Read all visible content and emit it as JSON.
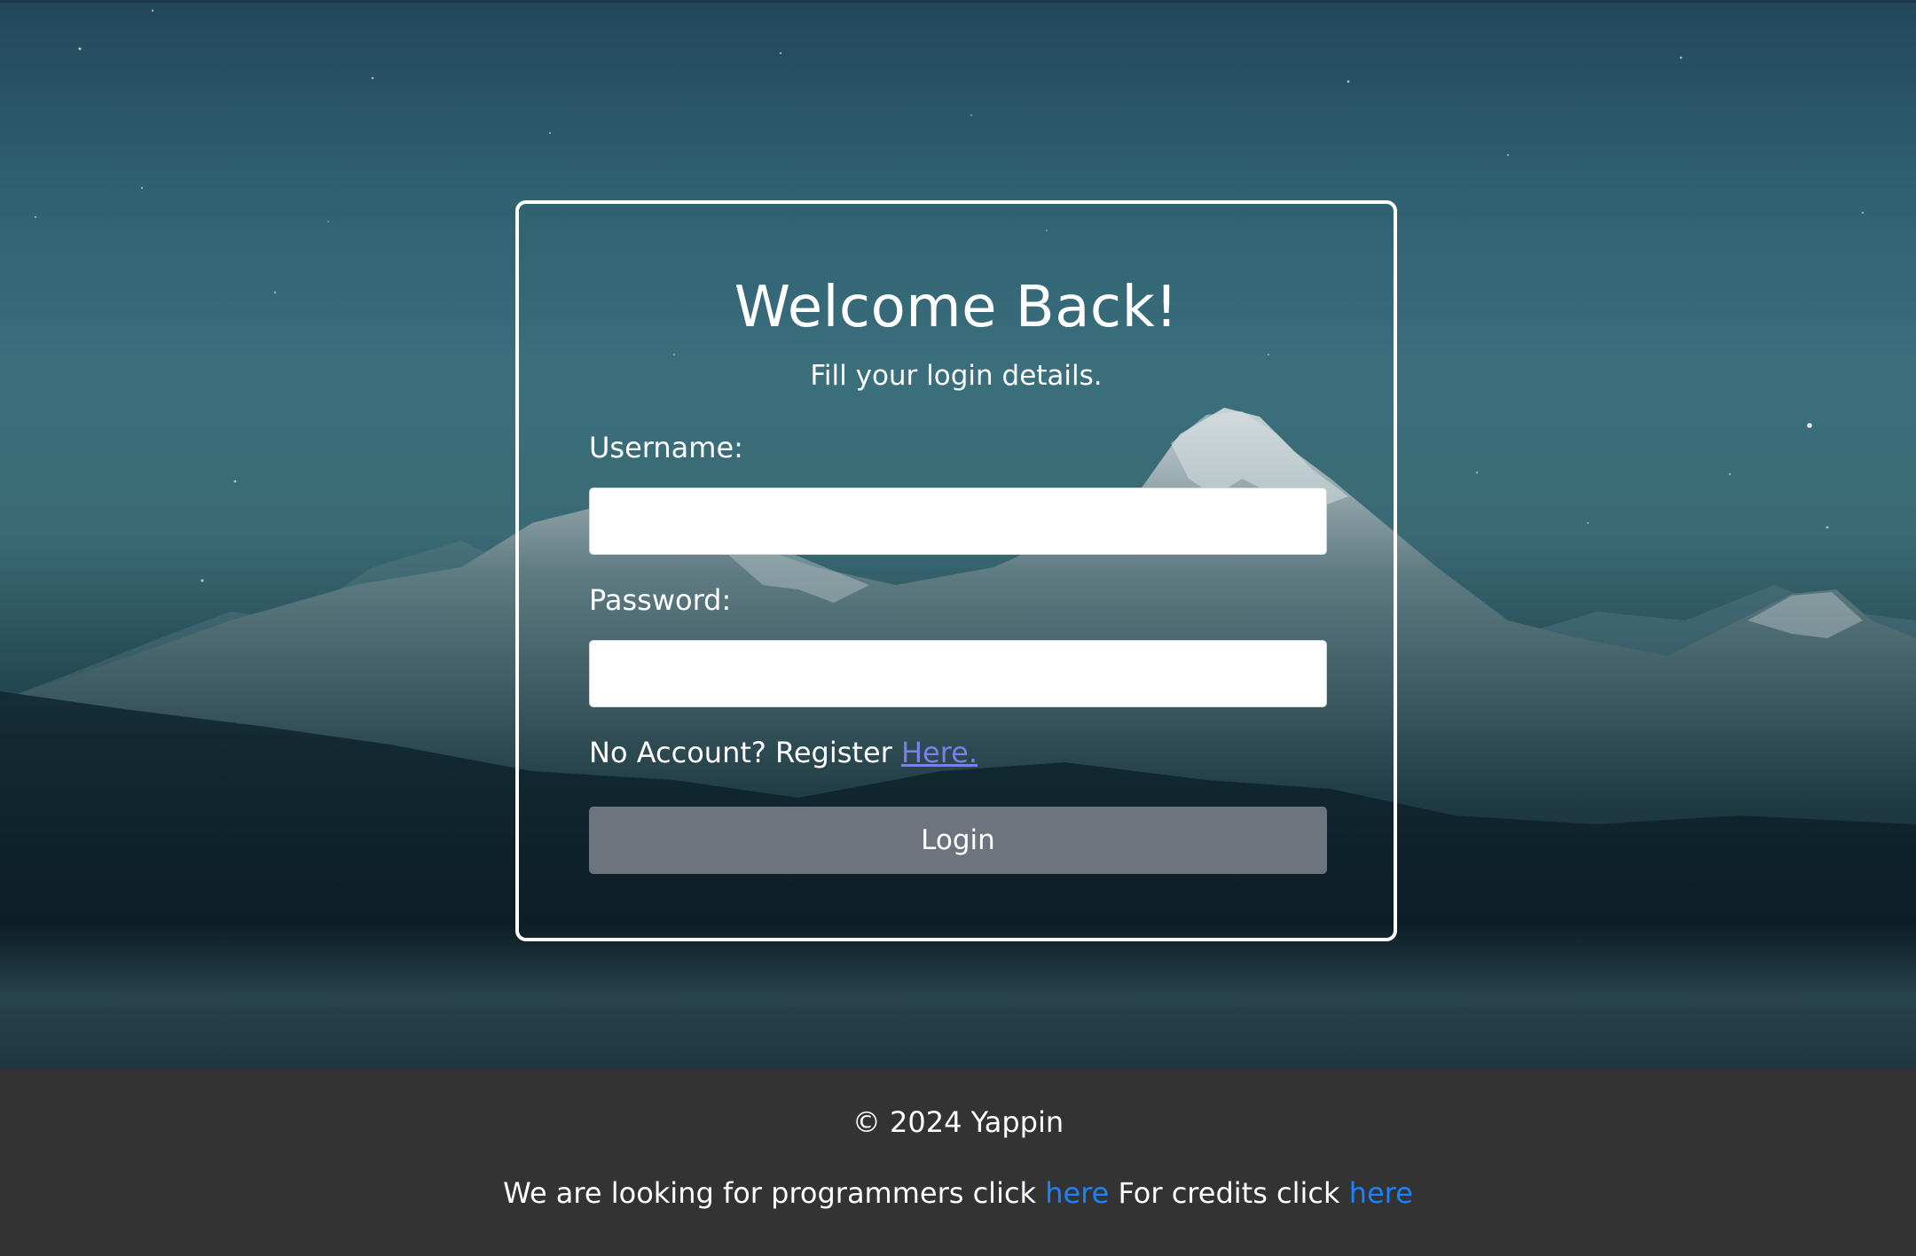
{
  "colors": {
    "card_border": "#ffffff",
    "button_bg": "#6c757d",
    "register_link": "#7b7fe6",
    "footer_bg": "#333333",
    "footer_link": "#1a82ff"
  },
  "login": {
    "title": "Welcome Back!",
    "subtitle": "Fill your login details.",
    "username_label": "Username:",
    "username_value": "",
    "password_label": "Password:",
    "password_value": "",
    "register_prompt": "No Account? Register ",
    "register_link": "Here.",
    "login_button": "Login"
  },
  "footer": {
    "copyright": "© 2024 Yappin",
    "programmers_text": "We are looking for programmers click ",
    "programmers_link": "here",
    "credits_text": " For credits click ",
    "credits_link": "here"
  }
}
